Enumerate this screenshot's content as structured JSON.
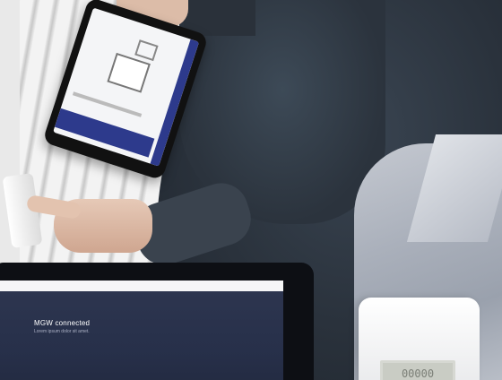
{
  "laptop_screen": {
    "title": "MGW connected",
    "subtitle": "Lorem ipsum dolor sit amet."
  },
  "meter": {
    "display_value": "00000"
  }
}
